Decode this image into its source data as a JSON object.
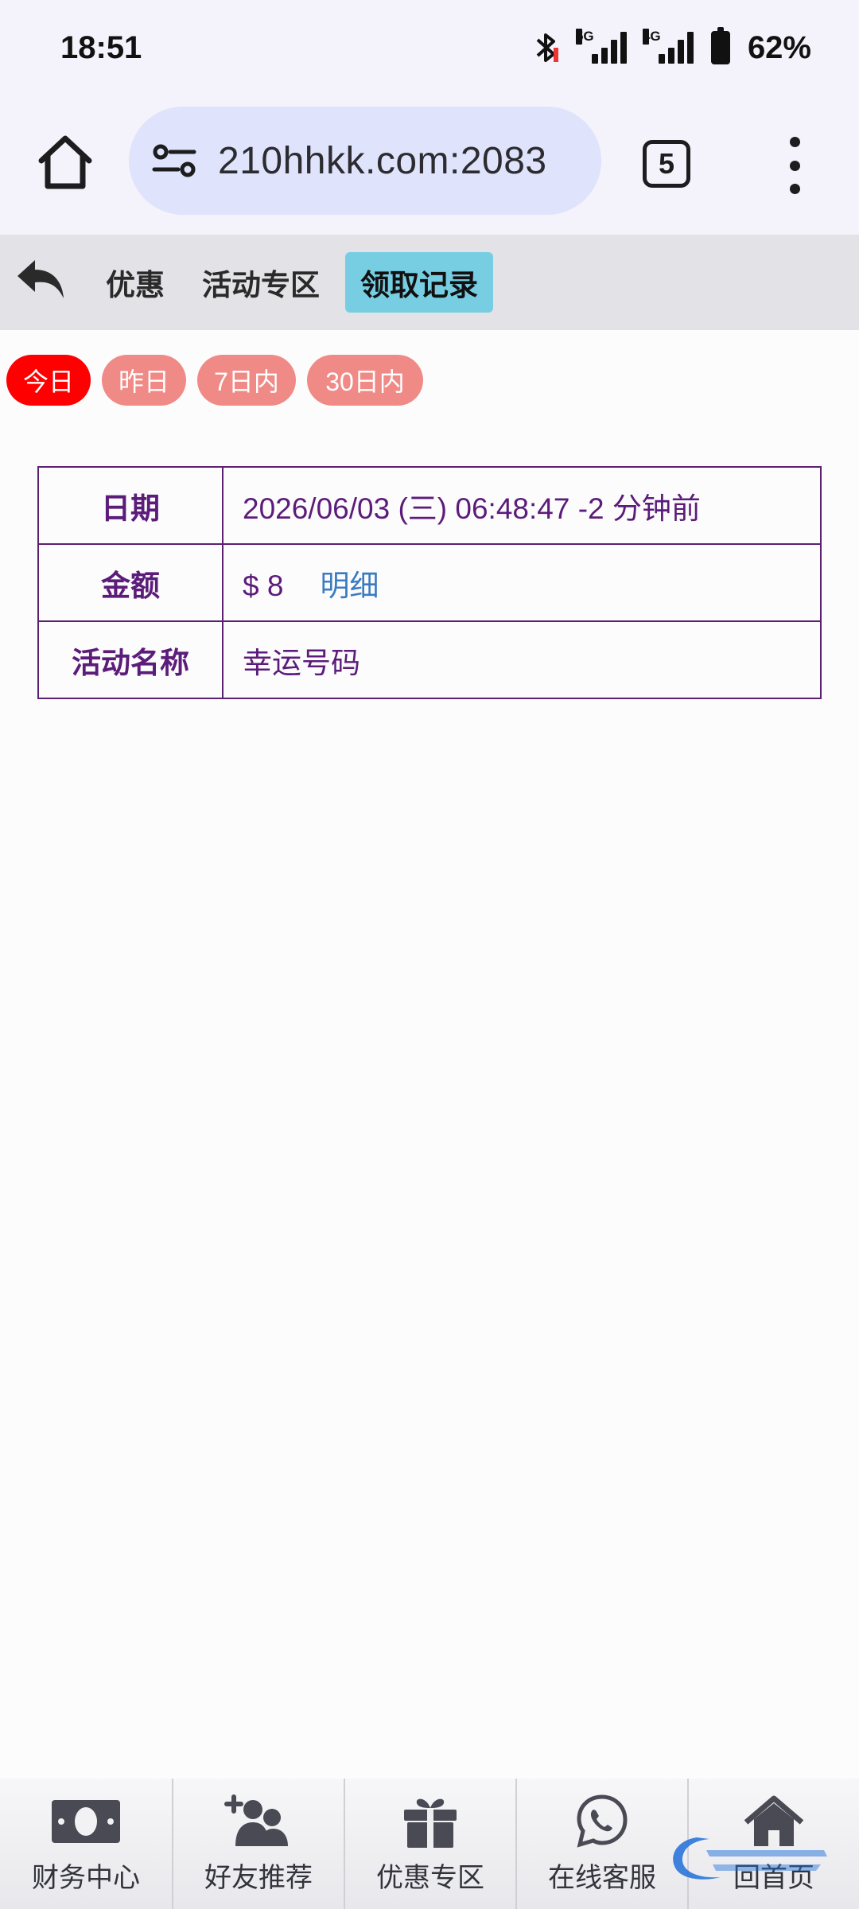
{
  "status_bar": {
    "time": "18:51",
    "network_1": "5G",
    "network_2": "4G",
    "battery": "62%"
  },
  "browser": {
    "url": "210hhkk.com:2083",
    "tab_count": "5"
  },
  "nav": {
    "items": [
      "优惠",
      "活动专区",
      "领取记录"
    ],
    "active_index": 2
  },
  "filters": {
    "items": [
      "今日",
      "昨日",
      "7日内",
      "30日内"
    ],
    "active_index": 0
  },
  "record": {
    "date_label": "日期",
    "date_value": "2026/06/03 (三) 06:48:47 -2 分钟前",
    "amount_label": "金额",
    "amount_value": "$ 8",
    "detail_link": "明细",
    "activity_label": "活动名称",
    "activity_value": "幸运号码"
  },
  "tab_bar": {
    "items": [
      {
        "label": "财务中心",
        "icon": "cash-icon"
      },
      {
        "label": "好友推荐",
        "icon": "add-friends-icon"
      },
      {
        "label": "优惠专区",
        "icon": "gift-icon"
      },
      {
        "label": "在线客服",
        "icon": "whatsapp-icon"
      },
      {
        "label": "回首页",
        "icon": "home-icon"
      }
    ]
  },
  "colors": {
    "active_nav": "#77cde2",
    "chip": "#f08a86",
    "chip_active": "#ff0000",
    "table_text": "#5c1c7a",
    "link": "#3a7cc0"
  }
}
